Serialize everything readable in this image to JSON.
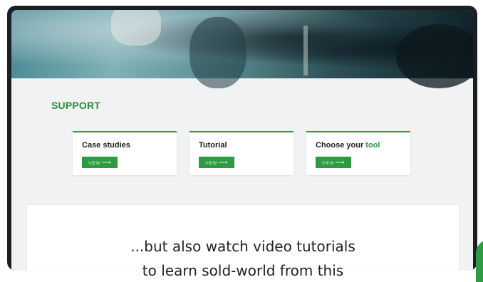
{
  "support": {
    "title": "SUPPORT",
    "cards": [
      {
        "title": "Case studies",
        "button_label": "VIEW",
        "button_icon": "arrow-right-icon"
      },
      {
        "title": "Tutorial",
        "button_label": "VIEW",
        "button_icon": "arrow-right-icon"
      },
      {
        "title_prefix": "Choose your",
        "title_accent": "tool",
        "button_label": "VIEW",
        "button_icon": "arrow-right-icon"
      }
    ]
  },
  "caption": {
    "line1": "...but also watch video tutorials",
    "line2": "to learn sold-world from this"
  },
  "colors": {
    "accent_green": "#2e9b44",
    "title_green": "#2e8b3a",
    "frame": "#1b1f22",
    "page_bg": "#f0f2f3"
  }
}
